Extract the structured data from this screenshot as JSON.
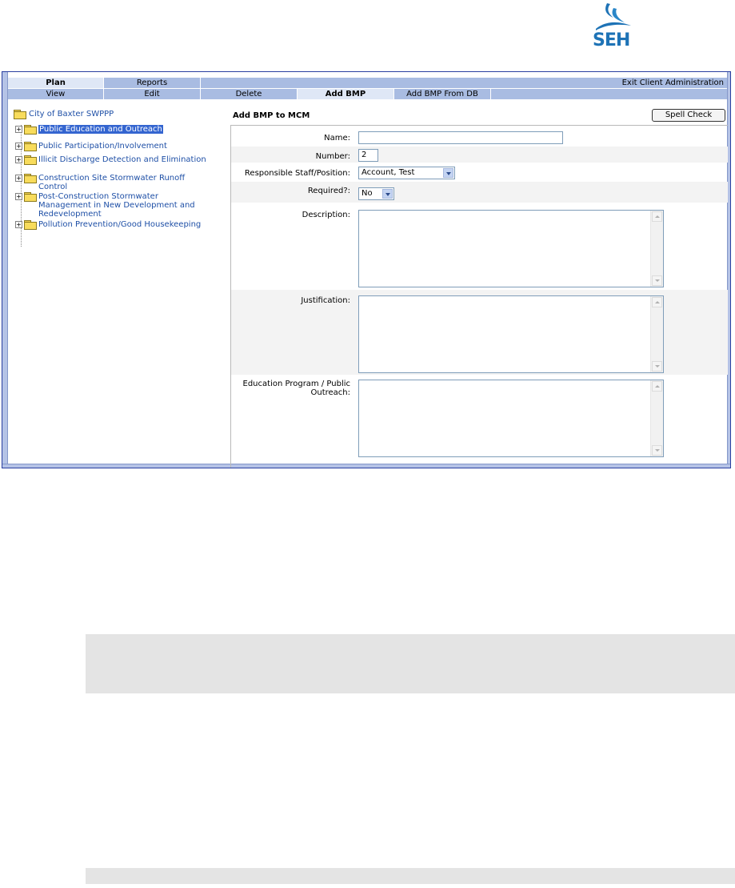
{
  "logo": {
    "text": "SEH",
    "brand_color": "#1e73b6"
  },
  "tabs_row1": [
    {
      "label": "Plan",
      "active": true
    },
    {
      "label": "Reports",
      "active": false
    }
  ],
  "exit_label": "Exit Client Administration",
  "tabs_row2": [
    {
      "label": "View",
      "active": false
    },
    {
      "label": "Edit",
      "active": false
    },
    {
      "label": "Delete",
      "active": false
    },
    {
      "label": "Add BMP",
      "active": true
    },
    {
      "label": "Add BMP From DB",
      "active": false
    }
  ],
  "tree": {
    "root": "City of Baxter SWPPP",
    "items": [
      {
        "label": "Public Education and Outreach",
        "selected": true
      },
      {
        "label": "Public Participation/Involvement"
      },
      {
        "label": "Illicit Discharge Detection and Elimination"
      },
      {
        "label": "Construction Site Stormwater Runoff Control"
      },
      {
        "label": "Post-Construction Stormwater Management in New Development and Redevelopment"
      },
      {
        "label": "Pollution Prevention/Good Housekeeping"
      }
    ]
  },
  "form": {
    "title": "Add BMP to MCM",
    "spell_check": "Spell Check",
    "name_label": "Name:",
    "name_value": "",
    "number_label": "Number:",
    "number_value": "2",
    "staff_label": "Responsible Staff/Position:",
    "staff_value": "Account, Test",
    "required_label": "Required?:",
    "required_value": "No",
    "description_label": "Description:",
    "justification_label": "Justification:",
    "education_label": "Education Program / Public Outreach:"
  },
  "colors": {
    "tab_bg": "#a9bce2",
    "tab_active": "#dfe7f6",
    "link": "#1e4fa6",
    "selection": "#3465d0"
  }
}
